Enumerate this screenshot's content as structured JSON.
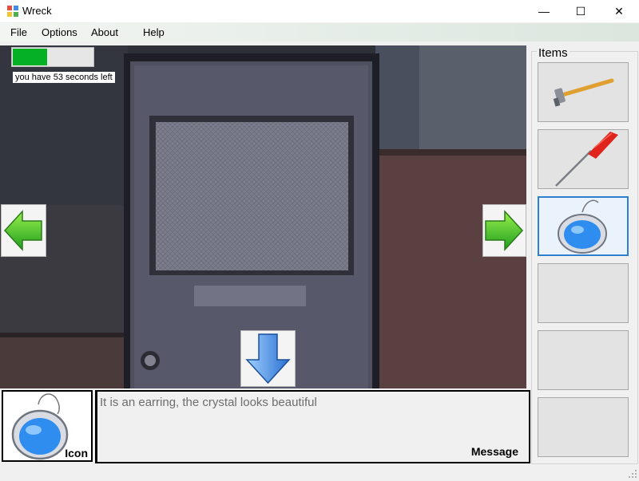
{
  "window": {
    "title": "Wreck",
    "minimize_glyph": "—",
    "maximize_glyph": "☐",
    "close_glyph": "✕",
    "app_icon": "app-icon"
  },
  "menu": {
    "items": [
      {
        "label": "File"
      },
      {
        "label": "Options"
      },
      {
        "label": "About"
      },
      {
        "label": "Help"
      }
    ]
  },
  "hud": {
    "timer_text": "you have 53 seconds left",
    "timer_progress": 0.43,
    "timer_color": "#06b025"
  },
  "navigation": {
    "left_icon": "green-arrow-left-icon",
    "right_icon": "green-arrow-right-icon",
    "down_icon": "blue-arrow-down-icon"
  },
  "items_panel": {
    "title": "Items",
    "slots": [
      {
        "item": "hammer",
        "selected": false
      },
      {
        "item": "screwdriver",
        "selected": false
      },
      {
        "item": "earring",
        "selected": true
      },
      {
        "item": "",
        "selected": false
      },
      {
        "item": "",
        "selected": false
      },
      {
        "item": "",
        "selected": false
      }
    ]
  },
  "icon_panel": {
    "label": "Icon",
    "item": "earring"
  },
  "message_panel": {
    "text": "It is an earring, the crystal looks beautiful",
    "label": "Message"
  }
}
